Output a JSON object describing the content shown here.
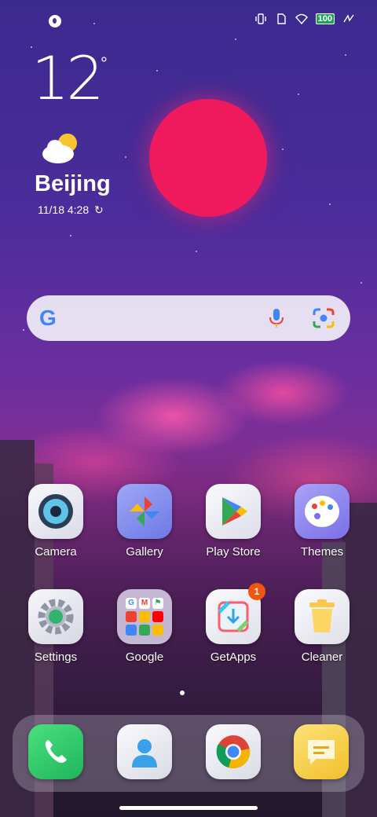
{
  "status_bar": {
    "left_icon": "app-notification-icon",
    "icons": [
      "vibrate-icon",
      "sim-icon",
      "wifi-icon",
      "battery-icon",
      "charging-icon"
    ],
    "battery_level": "100"
  },
  "weather_widget": {
    "temperature": "12",
    "degree_symbol": "°",
    "condition_icon": "partly-cloudy-icon",
    "city": "Beijing",
    "date_time": "11/18 4:28",
    "refresh_icon": "refresh-icon"
  },
  "search_bar": {
    "logo": "G",
    "mic_icon": "mic-icon",
    "lens_icon": "lens-icon"
  },
  "apps": [
    {
      "label": "Camera",
      "icon": "camera-icon"
    },
    {
      "label": "Gallery",
      "icon": "gallery-icon"
    },
    {
      "label": "Play Store",
      "icon": "play-store-icon"
    },
    {
      "label": "Themes",
      "icon": "themes-icon"
    },
    {
      "label": "Settings",
      "icon": "settings-icon"
    },
    {
      "label": "Google",
      "icon": "google-folder-icon"
    },
    {
      "label": "GetApps",
      "icon": "getapps-icon",
      "badge": "1"
    },
    {
      "label": "Cleaner",
      "icon": "cleaner-icon"
    }
  ],
  "dock": [
    {
      "icon": "phone-icon"
    },
    {
      "icon": "contacts-icon"
    },
    {
      "icon": "chrome-icon"
    },
    {
      "icon": "messages-icon"
    }
  ],
  "colors": {
    "sun": "#ef1a5e",
    "battery": "#1fa35c",
    "badge": "#f1550f"
  }
}
